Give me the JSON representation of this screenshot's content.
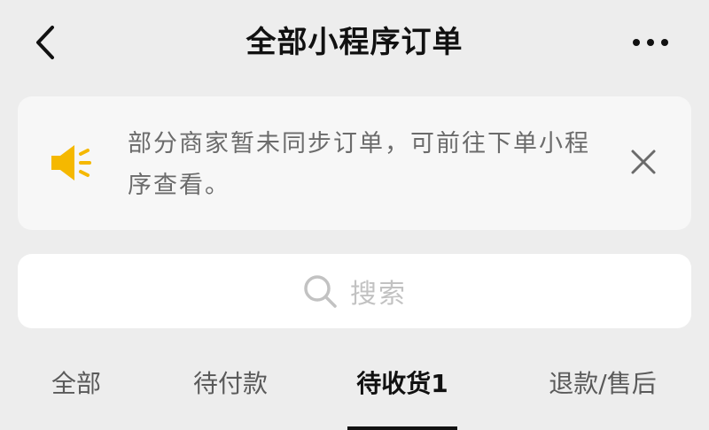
{
  "header": {
    "title": "全部小程序订单",
    "back_icon": "chevron-left-icon",
    "more_icon": "more-horizontal-icon"
  },
  "notice": {
    "icon": "megaphone-icon",
    "icon_color": "#f5b800",
    "text": "部分商家暂未同步订单，可前往下单小程序查看。",
    "close_icon": "close-icon"
  },
  "search": {
    "placeholder": "搜索",
    "icon": "search-icon"
  },
  "tabs": [
    {
      "label": "全部",
      "active": false
    },
    {
      "label": "待付款",
      "active": false
    },
    {
      "label": "待收货1",
      "active": true
    },
    {
      "label": "退款/售后",
      "active": false
    }
  ],
  "colors": {
    "background": "#ededed",
    "card": "#f7f7f7",
    "search_bg": "#ffffff",
    "accent": "#f5b800",
    "active_text": "#111111",
    "inactive_text": "#5a5a5a"
  }
}
